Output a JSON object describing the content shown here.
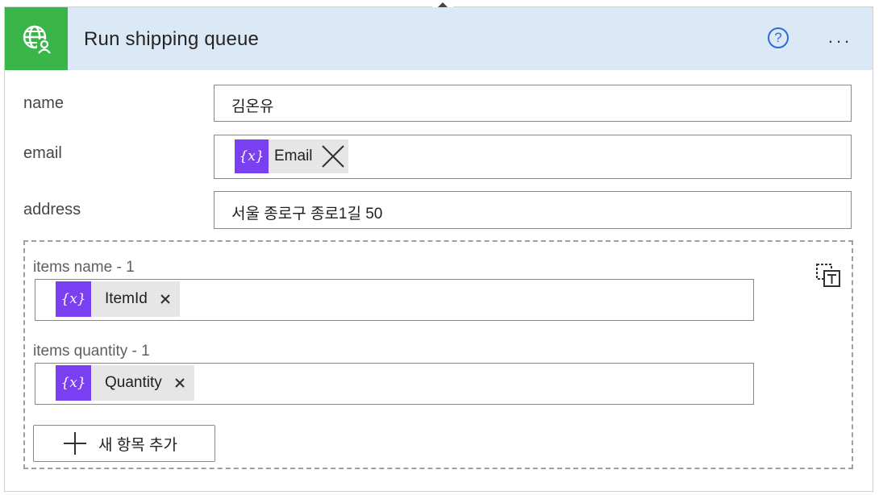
{
  "header": {
    "title": "Run shipping queue",
    "icon": "globe-person-icon",
    "icon_bg": "#39b54a",
    "bg": "#dbe9f7",
    "help_label": "?",
    "more_label": "..."
  },
  "fields": {
    "name": {
      "label": "name",
      "value": "김온유"
    },
    "email": {
      "label": "email",
      "token_icon": "{x}",
      "token_label": "Email"
    },
    "address": {
      "label": "address",
      "value": "서울 종로구 종로1길 50"
    }
  },
  "items": {
    "name": {
      "label": "items name - 1",
      "token_icon": "{x}",
      "token_label": "ItemId"
    },
    "quantity": {
      "label": "items quantity - 1",
      "token_icon": "{x}",
      "token_label": "Quantity"
    },
    "add_button_label": "새 항목 추가"
  },
  "colors": {
    "token_icon_bg": "#7b3ff2",
    "token_bg": "#e6e6e6",
    "accent": "#2f6ad8"
  }
}
